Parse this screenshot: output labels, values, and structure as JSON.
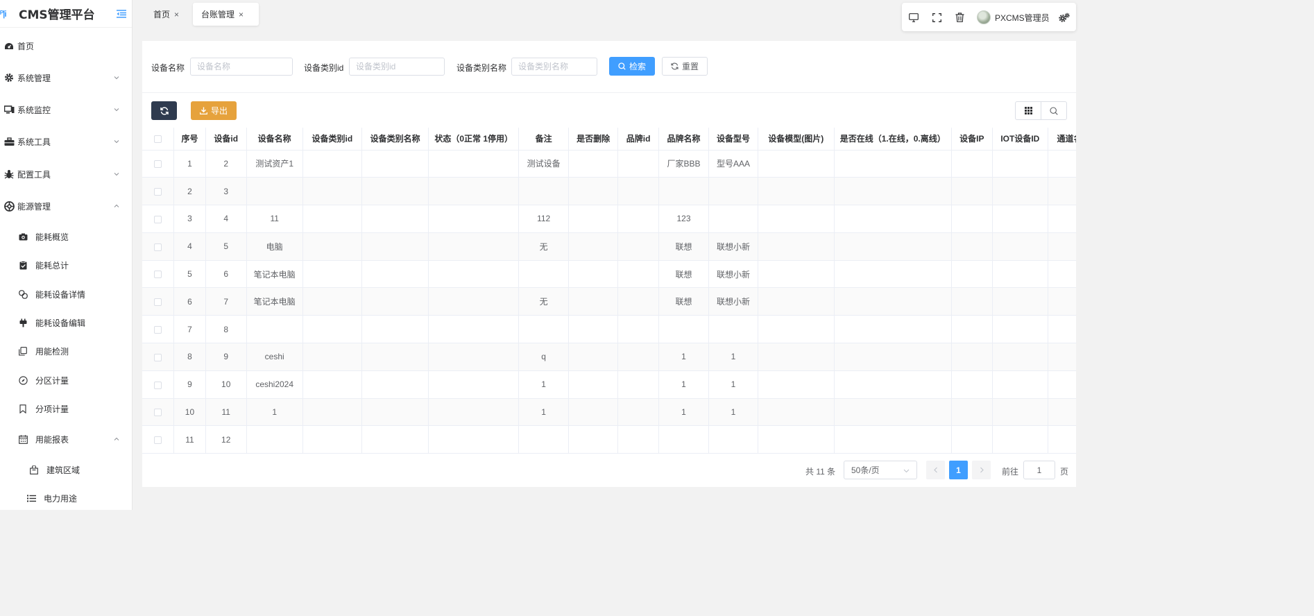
{
  "app": {
    "title": "CMS管理平台"
  },
  "sidebar": {
    "items": [
      {
        "label": "首页",
        "icon": "dashboard-icon"
      },
      {
        "label": "系统管理",
        "icon": "gear-icon"
      },
      {
        "label": "系统监控",
        "icon": "monitor-icon"
      },
      {
        "label": "系统工具",
        "icon": "toolbox-icon"
      },
      {
        "label": "配置工具",
        "icon": "bug-icon"
      },
      {
        "label": "能源管理",
        "icon": "energy-icon"
      }
    ],
    "sub_items": [
      {
        "label": "能耗概览",
        "icon": "camera-icon"
      },
      {
        "label": "能耗总计",
        "icon": "clipboard-check-icon"
      },
      {
        "label": "能耗设备详情",
        "icon": "link-icon"
      },
      {
        "label": "能耗设备编辑",
        "icon": "plug-icon"
      },
      {
        "label": "用能检测",
        "icon": "copy-icon"
      },
      {
        "label": "分区计量",
        "icon": "compass-icon"
      },
      {
        "label": "分项计量",
        "icon": "bookmark-icon"
      },
      {
        "label": "用能报表",
        "icon": "calendar-icon"
      }
    ],
    "sub_sub_items": [
      {
        "label": "建筑区域",
        "icon": "shopping-bag-icon"
      },
      {
        "label": "电力用途",
        "icon": "list-icon"
      }
    ]
  },
  "tabs": [
    {
      "label": "首页"
    },
    {
      "label": "台账管理"
    }
  ],
  "header": {
    "username": "PXCMS管理员"
  },
  "search": {
    "fields": [
      {
        "label": "设备名称",
        "placeholder": "设备名称"
      },
      {
        "label": "设备类别id",
        "placeholder": "设备类别id"
      },
      {
        "label": "设备类别名称",
        "placeholder": "设备类别名称"
      }
    ],
    "search_label": "检索",
    "reset_label": "重置"
  },
  "actions": {
    "export_label": "导出"
  },
  "table": {
    "headers": [
      "序号",
      "设备id",
      "设备名称",
      "设备类别id",
      "设备类别名称",
      "状态（0正常 1停用）",
      "备注",
      "是否删除",
      "品牌id",
      "品牌名称",
      "设备型号",
      "设备模型(图片)",
      "是否在线（1.在线，0.离线）",
      "设备IP",
      "IOT设备ID",
      "通道名称"
    ],
    "rows": [
      [
        "1",
        "2",
        "测试资产1",
        "",
        "",
        "",
        "测试设备",
        "",
        "",
        "厂家BBB",
        "型号AAA",
        "",
        "",
        "",
        "",
        ""
      ],
      [
        "2",
        "3",
        "",
        "",
        "",
        "",
        "",
        "",
        "",
        "",
        "",
        "",
        "",
        "",
        "",
        ""
      ],
      [
        "3",
        "4",
        "11",
        "",
        "",
        "",
        "112",
        "",
        "",
        "123",
        "",
        "",
        "",
        "",
        "",
        ""
      ],
      [
        "4",
        "5",
        "电脑",
        "",
        "",
        "",
        "无",
        "",
        "",
        "联想",
        "联想小新",
        "",
        "",
        "",
        "",
        ""
      ],
      [
        "5",
        "6",
        "笔记本电脑",
        "",
        "",
        "",
        "",
        "",
        "",
        "联想",
        "联想小新",
        "",
        "",
        "",
        "",
        ""
      ],
      [
        "6",
        "7",
        "笔记本电脑",
        "",
        "",
        "",
        "无",
        "",
        "",
        "联想",
        "联想小新",
        "",
        "",
        "",
        "",
        ""
      ],
      [
        "7",
        "8",
        "",
        "",
        "",
        "",
        "",
        "",
        "",
        "",
        "",
        "",
        "",
        "",
        "",
        ""
      ],
      [
        "8",
        "9",
        "ceshi",
        "",
        "",
        "",
        "q",
        "",
        "",
        "1",
        "1",
        "",
        "",
        "",
        "",
        ""
      ],
      [
        "9",
        "10",
        "ceshi2024",
        "",
        "",
        "",
        "1",
        "",
        "",
        "1",
        "1",
        "",
        "",
        "",
        "",
        ""
      ],
      [
        "10",
        "11",
        "1",
        "",
        "",
        "",
        "1",
        "",
        "",
        "1",
        "1",
        "",
        "",
        "",
        "",
        ""
      ],
      [
        "11",
        "12",
        "",
        "",
        "",
        "",
        "",
        "",
        "",
        "",
        "",
        "",
        "",
        "",
        "",
        ""
      ]
    ]
  },
  "pagination": {
    "total": "共 11 条",
    "page_size": "50条/页",
    "current_page": "1",
    "goto_label": "前往",
    "goto_value": "1",
    "page_label": "页"
  },
  "colors": {
    "primary": "#409eff",
    "warning": "#e6a23c",
    "dark": "#2f3b4f"
  }
}
